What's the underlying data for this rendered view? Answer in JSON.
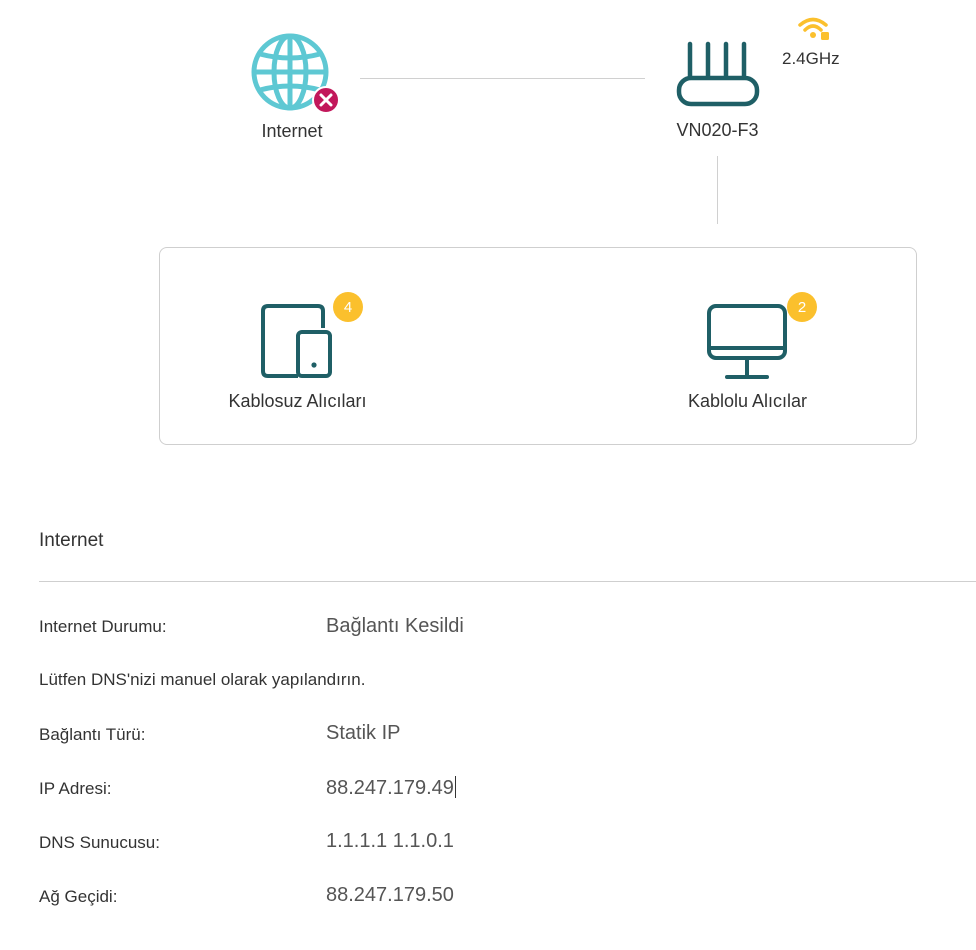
{
  "topology": {
    "internet_label": "Internet",
    "router_label": "VN020-F3",
    "band_label": "2.4GHz",
    "wireless_clients": {
      "label": "Kablosuz Alıcıları",
      "count": "4"
    },
    "wired_clients": {
      "label": "Kablolu Alıcılar",
      "count": "2"
    }
  },
  "internet_section": {
    "title": "Internet",
    "status_label": "Internet Durumu:",
    "status_value": "Bağlantı Kesildi",
    "dns_notice": "Lütfen DNS'nizi manuel olarak yapılandırın.",
    "type_label": "Bağlantı Türü:",
    "type_value": "Statik IP",
    "ip_label": "IP Adresi:",
    "ip_value": "88.247.179.49",
    "dns_label": "DNS Sunucusu:",
    "dns_value": "1.1.1.1 1.1.0.1",
    "gateway_label": "Ağ Geçidi:",
    "gateway_value": "88.247.179.50"
  },
  "colors": {
    "globe": "#5ec8d3",
    "device_icon": "#1f5f66",
    "error_badge": "#c2185b",
    "count_badge": "#fbc02d",
    "wifi_icon": "#fbc02d"
  }
}
